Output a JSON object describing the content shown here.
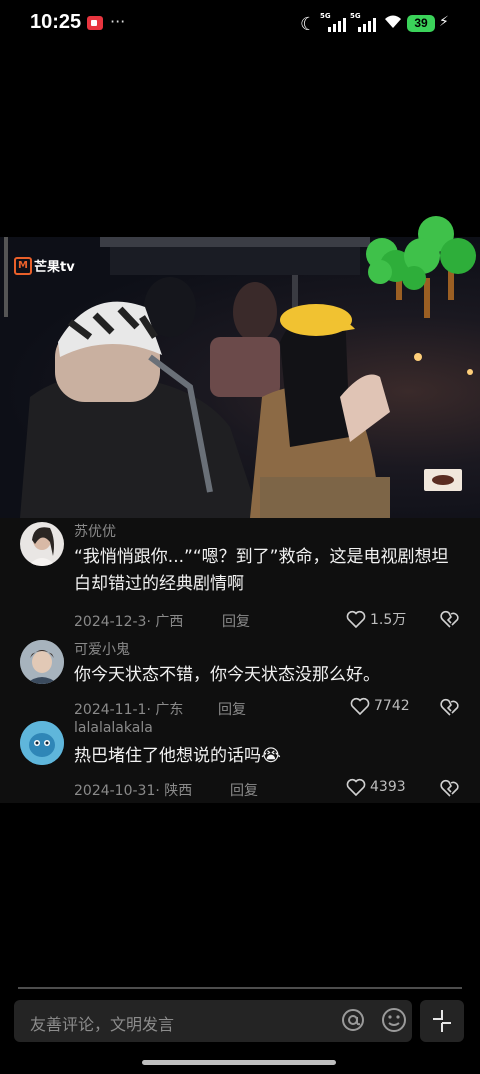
{
  "status_bar": {
    "time": "10:25",
    "dots": "···",
    "signal1_label": "5G",
    "signal2_label": "5G",
    "battery": "39"
  },
  "video": {
    "channel_logo_text": "芒果tv"
  },
  "comments": [
    {
      "user": "苏优优",
      "text": "“我悄悄跟你...”“嗯？到了”救命，这是电视剧想坦白却错过的经典剧情啊",
      "date": "2024-12-3· 广西",
      "reply": "回复",
      "likes": "1.5万"
    },
    {
      "user": "可爱小鬼",
      "text": "你今天状态不错，你今天状态没那么好。",
      "date": "2024-11-1· 广东",
      "reply": "回复",
      "likes": "7742"
    },
    {
      "user": "lalalalakala",
      "text": "热巴堵住了他想说的话吗😭",
      "date": "2024-10-31· 陕西",
      "reply": "回复",
      "likes": "4393"
    }
  ],
  "input": {
    "placeholder": "友善评论，文明发言"
  },
  "colors": {
    "background": "#000000",
    "comment_panel": "#0f0f0f",
    "input_bg": "#242424",
    "battery_green": "#3bd35a",
    "logo_orange": "#e9602a"
  }
}
